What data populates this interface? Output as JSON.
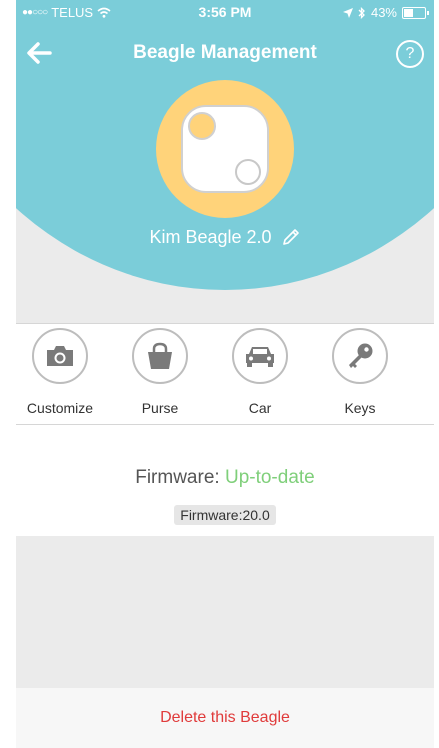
{
  "status_bar": {
    "carrier": "TELUS",
    "time": "3:56 PM",
    "battery": "43%",
    "battery_level": 0.43
  },
  "nav": {
    "title": "Beagle Management",
    "help_label": "?"
  },
  "device": {
    "name": "Kim Beagle 2.0"
  },
  "categories": [
    {
      "label": "Customize",
      "icon": "camera-icon"
    },
    {
      "label": "Purse",
      "icon": "bag-icon"
    },
    {
      "label": "Car",
      "icon": "car-icon"
    },
    {
      "label": "Keys",
      "icon": "key-icon"
    }
  ],
  "firmware": {
    "label": "Firmware:",
    "status": "Up-to-date",
    "version": "Firmware:20.0"
  },
  "actions": {
    "delete_label": "Delete this Beagle"
  },
  "colors": {
    "teal": "#7bcdd9",
    "avatar_ring": "#ffd37a",
    "success": "#7fcf7a",
    "danger": "#e03b3b"
  }
}
